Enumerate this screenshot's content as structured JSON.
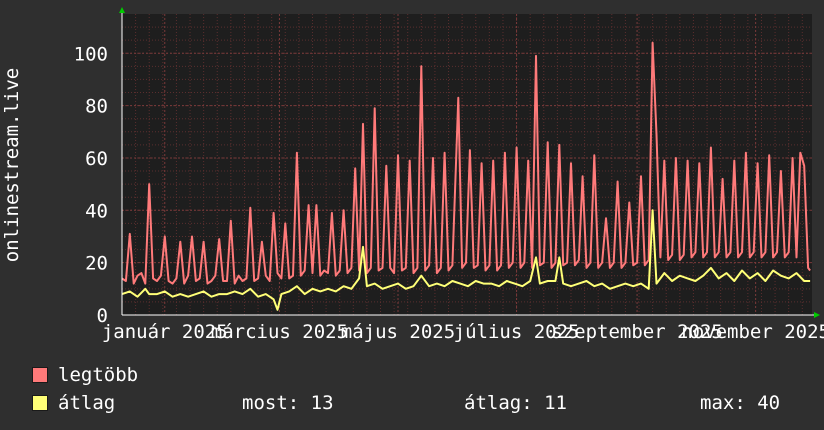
{
  "colors": {
    "background": "#2f2f2f",
    "plot_background": "#1e1e1e",
    "grid": "#5a2e2e",
    "text": "#ffffff",
    "max_series": "#ff7a7a",
    "avg_series": "#ffff77",
    "axis_arrow": "#00cc00"
  },
  "chart_data": {
    "type": "line",
    "ylabel": "onlinestream.live",
    "ylim": [
      0,
      115
    ],
    "yticks": [
      0,
      20,
      40,
      60,
      80,
      100
    ],
    "xlim": [
      "2024-12-10",
      "2025-11-30"
    ],
    "xtick_labels": [
      {
        "date": "2025-01-01",
        "label": "január 2025"
      },
      {
        "date": "2025-03-01",
        "label": "március 2025"
      },
      {
        "date": "2025-05-01",
        "label": "május 2025"
      },
      {
        "date": "2025-07-01",
        "label": "július 2025"
      },
      {
        "date": "2025-09-01",
        "label": "szeptember 2025"
      },
      {
        "date": "2025-11-01",
        "label": "november 2025"
      }
    ],
    "grid": true,
    "series": [
      {
        "name": "legtöbb",
        "color": "#ff7a7a",
        "points": [
          [
            "2024-12-10",
            14
          ],
          [
            "2024-12-12",
            13
          ],
          [
            "2024-12-14",
            31
          ],
          [
            "2024-12-16",
            12
          ],
          [
            "2024-12-18",
            15
          ],
          [
            "2024-12-20",
            16
          ],
          [
            "2024-12-22",
            12
          ],
          [
            "2024-12-24",
            50
          ],
          [
            "2024-12-26",
            14
          ],
          [
            "2024-12-28",
            13
          ],
          [
            "2024-12-30",
            15
          ],
          [
            "2025-01-01",
            30
          ],
          [
            "2025-01-03",
            13
          ],
          [
            "2025-01-05",
            12
          ],
          [
            "2025-01-07",
            14
          ],
          [
            "2025-01-09",
            28
          ],
          [
            "2025-01-11",
            12
          ],
          [
            "2025-01-13",
            15
          ],
          [
            "2025-01-15",
            30
          ],
          [
            "2025-01-17",
            13
          ],
          [
            "2025-01-19",
            14
          ],
          [
            "2025-01-21",
            28
          ],
          [
            "2025-01-23",
            12
          ],
          [
            "2025-01-25",
            13
          ],
          [
            "2025-01-27",
            15
          ],
          [
            "2025-01-29",
            29
          ],
          [
            "2025-01-31",
            13
          ],
          [
            "2025-02-02",
            13
          ],
          [
            "2025-02-04",
            36
          ],
          [
            "2025-02-06",
            12
          ],
          [
            "2025-02-08",
            15
          ],
          [
            "2025-02-10",
            13
          ],
          [
            "2025-02-12",
            14
          ],
          [
            "2025-02-14",
            41
          ],
          [
            "2025-02-16",
            13
          ],
          [
            "2025-02-18",
            14
          ],
          [
            "2025-02-20",
            28
          ],
          [
            "2025-02-22",
            15
          ],
          [
            "2025-02-24",
            13
          ],
          [
            "2025-02-26",
            39
          ],
          [
            "2025-02-28",
            16
          ],
          [
            "2025-03-02",
            14
          ],
          [
            "2025-03-04",
            35
          ],
          [
            "2025-03-06",
            14
          ],
          [
            "2025-03-08",
            15
          ],
          [
            "2025-03-10",
            62
          ],
          [
            "2025-03-12",
            15
          ],
          [
            "2025-03-14",
            17
          ],
          [
            "2025-03-16",
            42
          ],
          [
            "2025-03-18",
            16
          ],
          [
            "2025-03-20",
            42
          ],
          [
            "2025-03-22",
            15
          ],
          [
            "2025-03-24",
            17
          ],
          [
            "2025-03-26",
            16
          ],
          [
            "2025-03-28",
            39
          ],
          [
            "2025-03-30",
            15
          ],
          [
            "2025-04-01",
            17
          ],
          [
            "2025-04-03",
            40
          ],
          [
            "2025-04-05",
            16
          ],
          [
            "2025-04-07",
            18
          ],
          [
            "2025-04-09",
            56
          ],
          [
            "2025-04-11",
            17
          ],
          [
            "2025-04-13",
            73
          ],
          [
            "2025-04-15",
            16
          ],
          [
            "2025-04-17",
            18
          ],
          [
            "2025-04-19",
            79
          ],
          [
            "2025-04-21",
            17
          ],
          [
            "2025-04-23",
            18
          ],
          [
            "2025-04-25",
            57
          ],
          [
            "2025-04-27",
            18
          ],
          [
            "2025-04-29",
            16
          ],
          [
            "2025-05-01",
            61
          ],
          [
            "2025-05-03",
            17
          ],
          [
            "2025-05-05",
            18
          ],
          [
            "2025-05-07",
            59
          ],
          [
            "2025-05-09",
            16
          ],
          [
            "2025-05-11",
            18
          ],
          [
            "2025-05-13",
            95
          ],
          [
            "2025-05-15",
            17
          ],
          [
            "2025-05-17",
            19
          ],
          [
            "2025-05-19",
            60
          ],
          [
            "2025-05-21",
            16
          ],
          [
            "2025-05-23",
            18
          ],
          [
            "2025-05-25",
            62
          ],
          [
            "2025-05-27",
            17
          ],
          [
            "2025-05-29",
            19
          ],
          [
            "2025-06-01",
            83
          ],
          [
            "2025-06-03",
            18
          ],
          [
            "2025-06-05",
            20
          ],
          [
            "2025-06-07",
            63
          ],
          [
            "2025-06-09",
            18
          ],
          [
            "2025-06-11",
            19
          ],
          [
            "2025-06-13",
            58
          ],
          [
            "2025-06-15",
            17
          ],
          [
            "2025-06-17",
            19
          ],
          [
            "2025-06-19",
            59
          ],
          [
            "2025-06-21",
            17
          ],
          [
            "2025-06-23",
            19
          ],
          [
            "2025-06-25",
            62
          ],
          [
            "2025-06-27",
            18
          ],
          [
            "2025-06-29",
            20
          ],
          [
            "2025-07-01",
            64
          ],
          [
            "2025-07-03",
            18
          ],
          [
            "2025-07-05",
            20
          ],
          [
            "2025-07-07",
            59
          ],
          [
            "2025-07-09",
            18
          ],
          [
            "2025-07-11",
            99
          ],
          [
            "2025-07-13",
            19
          ],
          [
            "2025-07-15",
            20
          ],
          [
            "2025-07-17",
            66
          ],
          [
            "2025-07-19",
            18
          ],
          [
            "2025-07-21",
            20
          ],
          [
            "2025-07-23",
            65
          ],
          [
            "2025-07-25",
            19
          ],
          [
            "2025-07-27",
            20
          ],
          [
            "2025-07-29",
            58
          ],
          [
            "2025-07-31",
            19
          ],
          [
            "2025-08-02",
            21
          ],
          [
            "2025-08-04",
            53
          ],
          [
            "2025-08-06",
            18
          ],
          [
            "2025-08-08",
            20
          ],
          [
            "2025-08-10",
            61
          ],
          [
            "2025-08-12",
            18
          ],
          [
            "2025-08-14",
            20
          ],
          [
            "2025-08-16",
            37
          ],
          [
            "2025-08-18",
            18
          ],
          [
            "2025-08-20",
            20
          ],
          [
            "2025-08-22",
            51
          ],
          [
            "2025-08-24",
            18
          ],
          [
            "2025-08-26",
            20
          ],
          [
            "2025-08-28",
            43
          ],
          [
            "2025-08-30",
            19
          ],
          [
            "2025-09-01",
            20
          ],
          [
            "2025-09-03",
            53
          ],
          [
            "2025-09-05",
            19
          ],
          [
            "2025-09-07",
            21
          ],
          [
            "2025-09-09",
            104
          ],
          [
            "2025-09-11",
            69
          ],
          [
            "2025-09-13",
            22
          ],
          [
            "2025-09-15",
            59
          ],
          [
            "2025-09-17",
            21
          ],
          [
            "2025-09-19",
            23
          ],
          [
            "2025-09-21",
            60
          ],
          [
            "2025-09-23",
            21
          ],
          [
            "2025-09-25",
            23
          ],
          [
            "2025-09-27",
            59
          ],
          [
            "2025-09-29",
            22
          ],
          [
            "2025-10-01",
            24
          ],
          [
            "2025-10-03",
            58
          ],
          [
            "2025-10-05",
            22
          ],
          [
            "2025-10-07",
            24
          ],
          [
            "2025-10-09",
            64
          ],
          [
            "2025-10-11",
            22
          ],
          [
            "2025-10-13",
            24
          ],
          [
            "2025-10-15",
            52
          ],
          [
            "2025-10-17",
            22
          ],
          [
            "2025-10-19",
            24
          ],
          [
            "2025-10-21",
            59
          ],
          [
            "2025-10-23",
            22
          ],
          [
            "2025-10-25",
            24
          ],
          [
            "2025-10-27",
            62
          ],
          [
            "2025-10-29",
            22
          ],
          [
            "2025-10-31",
            24
          ],
          [
            "2025-11-02",
            58
          ],
          [
            "2025-11-04",
            22
          ],
          [
            "2025-11-06",
            24
          ],
          [
            "2025-11-08",
            61
          ],
          [
            "2025-11-10",
            22
          ],
          [
            "2025-11-12",
            24
          ],
          [
            "2025-11-14",
            55
          ],
          [
            "2025-11-16",
            22
          ],
          [
            "2025-11-18",
            24
          ],
          [
            "2025-11-20",
            60
          ],
          [
            "2025-11-22",
            22
          ],
          [
            "2025-11-24",
            62
          ],
          [
            "2025-11-26",
            57
          ],
          [
            "2025-11-28",
            18
          ],
          [
            "2025-11-29",
            17
          ]
        ]
      },
      {
        "name": "átlag",
        "color": "#ffff77",
        "points": [
          [
            "2024-12-10",
            8
          ],
          [
            "2024-12-14",
            9
          ],
          [
            "2024-12-18",
            7
          ],
          [
            "2024-12-22",
            10
          ],
          [
            "2024-12-24",
            8
          ],
          [
            "2024-12-28",
            8
          ],
          [
            "2025-01-01",
            9
          ],
          [
            "2025-01-05",
            7
          ],
          [
            "2025-01-09",
            8
          ],
          [
            "2025-01-13",
            7
          ],
          [
            "2025-01-17",
            8
          ],
          [
            "2025-01-21",
            9
          ],
          [
            "2025-01-25",
            7
          ],
          [
            "2025-01-29",
            8
          ],
          [
            "2025-02-02",
            8
          ],
          [
            "2025-02-06",
            9
          ],
          [
            "2025-02-10",
            8
          ],
          [
            "2025-02-14",
            10
          ],
          [
            "2025-02-18",
            7
          ],
          [
            "2025-02-22",
            8
          ],
          [
            "2025-02-26",
            6
          ],
          [
            "2025-02-28",
            2
          ],
          [
            "2025-03-02",
            8
          ],
          [
            "2025-03-06",
            9
          ],
          [
            "2025-03-10",
            11
          ],
          [
            "2025-03-14",
            8
          ],
          [
            "2025-03-18",
            10
          ],
          [
            "2025-03-22",
            9
          ],
          [
            "2025-03-26",
            10
          ],
          [
            "2025-03-30",
            9
          ],
          [
            "2025-04-03",
            11
          ],
          [
            "2025-04-07",
            10
          ],
          [
            "2025-04-11",
            14
          ],
          [
            "2025-04-13",
            26
          ],
          [
            "2025-04-15",
            11
          ],
          [
            "2025-04-19",
            12
          ],
          [
            "2025-04-23",
            10
          ],
          [
            "2025-04-27",
            11
          ],
          [
            "2025-05-01",
            12
          ],
          [
            "2025-05-05",
            10
          ],
          [
            "2025-05-09",
            11
          ],
          [
            "2025-05-13",
            15
          ],
          [
            "2025-05-17",
            11
          ],
          [
            "2025-05-21",
            12
          ],
          [
            "2025-05-25",
            11
          ],
          [
            "2025-05-29",
            13
          ],
          [
            "2025-06-02",
            12
          ],
          [
            "2025-06-06",
            11
          ],
          [
            "2025-06-10",
            13
          ],
          [
            "2025-06-14",
            12
          ],
          [
            "2025-06-18",
            12
          ],
          [
            "2025-06-22",
            11
          ],
          [
            "2025-06-26",
            13
          ],
          [
            "2025-06-30",
            12
          ],
          [
            "2025-07-04",
            11
          ],
          [
            "2025-07-08",
            13
          ],
          [
            "2025-07-11",
            22
          ],
          [
            "2025-07-13",
            12
          ],
          [
            "2025-07-17",
            13
          ],
          [
            "2025-07-21",
            13
          ],
          [
            "2025-07-23",
            22
          ],
          [
            "2025-07-25",
            12
          ],
          [
            "2025-07-29",
            11
          ],
          [
            "2025-08-02",
            12
          ],
          [
            "2025-08-06",
            13
          ],
          [
            "2025-08-10",
            11
          ],
          [
            "2025-08-14",
            12
          ],
          [
            "2025-08-18",
            10
          ],
          [
            "2025-08-22",
            11
          ],
          [
            "2025-08-26",
            12
          ],
          [
            "2025-08-30",
            11
          ],
          [
            "2025-09-03",
            12
          ],
          [
            "2025-09-07",
            10
          ],
          [
            "2025-09-09",
            40
          ],
          [
            "2025-09-11",
            12
          ],
          [
            "2025-09-15",
            16
          ],
          [
            "2025-09-19",
            13
          ],
          [
            "2025-09-23",
            15
          ],
          [
            "2025-09-27",
            14
          ],
          [
            "2025-10-01",
            13
          ],
          [
            "2025-10-05",
            15
          ],
          [
            "2025-10-09",
            18
          ],
          [
            "2025-10-13",
            14
          ],
          [
            "2025-10-17",
            16
          ],
          [
            "2025-10-21",
            13
          ],
          [
            "2025-10-25",
            17
          ],
          [
            "2025-10-29",
            14
          ],
          [
            "2025-11-02",
            16
          ],
          [
            "2025-11-06",
            13
          ],
          [
            "2025-11-10",
            17
          ],
          [
            "2025-11-14",
            15
          ],
          [
            "2025-11-18",
            14
          ],
          [
            "2025-11-22",
            16
          ],
          [
            "2025-11-26",
            13
          ],
          [
            "2025-11-29",
            13
          ]
        ]
      }
    ]
  },
  "legend": {
    "items": [
      {
        "label": "legtöbb",
        "color": "#ff7a7a"
      },
      {
        "label": "átlag",
        "color": "#ffff77"
      }
    ],
    "stats": {
      "most": "most: 13",
      "atlag": "átlag: 11",
      "max": "max: 40"
    }
  }
}
